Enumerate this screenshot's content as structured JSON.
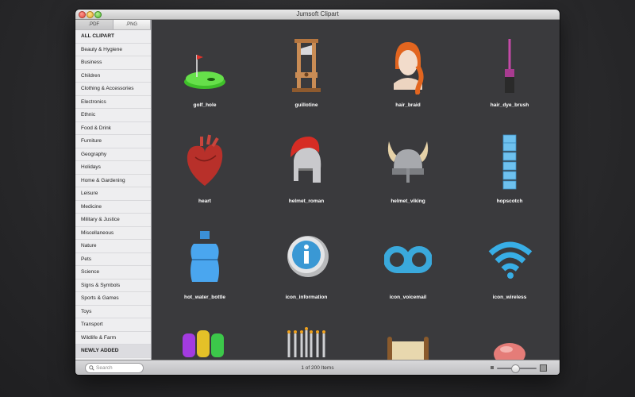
{
  "window": {
    "title": "Jumsoft Clipart"
  },
  "tabs": [
    {
      "label": ".PDF",
      "active": true
    },
    {
      "label": ".PNG",
      "active": false
    }
  ],
  "categories": [
    {
      "label": "ALL CLIPART",
      "style": "bold"
    },
    {
      "label": "Beauty & Hygiene"
    },
    {
      "label": "Business"
    },
    {
      "label": "Children"
    },
    {
      "label": "Clothing & Accessories"
    },
    {
      "label": "Electronics"
    },
    {
      "label": "Ethnic"
    },
    {
      "label": "Food & Drink"
    },
    {
      "label": "Furniture"
    },
    {
      "label": "Geography"
    },
    {
      "label": "Holidays"
    },
    {
      "label": "Home & Gardening"
    },
    {
      "label": "Leisure"
    },
    {
      "label": "Medicine"
    },
    {
      "label": "Military & Justice"
    },
    {
      "label": "Miscellaneous"
    },
    {
      "label": "Nature"
    },
    {
      "label": "Pets"
    },
    {
      "label": "Science"
    },
    {
      "label": "Signs & Symbols"
    },
    {
      "label": "Sports & Games"
    },
    {
      "label": "Toys"
    },
    {
      "label": "Transport"
    },
    {
      "label": "Wildlife & Farm"
    },
    {
      "label": "NEWLY ADDED",
      "style": "newly"
    }
  ],
  "items": [
    {
      "label": "golf_hole",
      "icon": "golf-hole-icon"
    },
    {
      "label": "guillotine",
      "icon": "guillotine-icon"
    },
    {
      "label": "hair_braid",
      "icon": "hair-braid-icon"
    },
    {
      "label": "hair_dye_brush",
      "icon": "hair-dye-brush-icon"
    },
    {
      "label": "heart",
      "icon": "anatomical-heart-icon"
    },
    {
      "label": "helmet_roman",
      "icon": "roman-helmet-icon"
    },
    {
      "label": "helmet_viking",
      "icon": "viking-helmet-icon"
    },
    {
      "label": "hopscotch",
      "icon": "hopscotch-icon"
    },
    {
      "label": "hot_water_bottle",
      "icon": "hot-water-bottle-icon"
    },
    {
      "label": "icon_information",
      "icon": "information-icon"
    },
    {
      "label": "icon_voicemail",
      "icon": "voicemail-icon"
    },
    {
      "label": "icon_wireless",
      "icon": "wireless-icon"
    },
    {
      "label": "",
      "icon": "colorful-letters-icon"
    },
    {
      "label": "",
      "icon": "menorah-icon"
    },
    {
      "label": "",
      "icon": "scroll-icon"
    },
    {
      "label": "",
      "icon": "pink-object-icon"
    }
  ],
  "status": {
    "search_placeholder": "Search",
    "count": "1 of 200 Items",
    "zoom_level": 0.45
  }
}
